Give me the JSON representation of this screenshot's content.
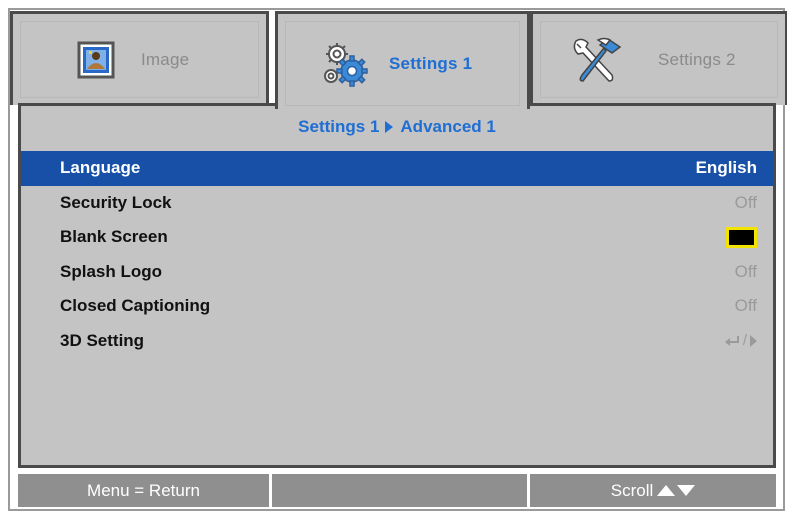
{
  "tabs": [
    {
      "label": "Image",
      "icon": "image-icon",
      "active": false
    },
    {
      "label": "Settings 1",
      "icon": "gears-icon",
      "active": true
    },
    {
      "label": "Settings 2",
      "icon": "tools-icon",
      "active": false
    }
  ],
  "breadcrumb": {
    "parent": "Settings 1",
    "current": "Advanced 1"
  },
  "menu": {
    "items": [
      {
        "name": "Language",
        "value": "English"
      },
      {
        "name": "Security Lock",
        "value": "Off"
      },
      {
        "name": "Blank Screen",
        "value": ""
      },
      {
        "name": "Splash Logo",
        "value": "Off"
      },
      {
        "name": "Closed Captioning",
        "value": "Off"
      },
      {
        "name": "3D Setting",
        "value": ""
      }
    ],
    "selected_index": 0,
    "blank_screen_color": "#000000"
  },
  "footer": {
    "menu_hint": "Menu = Return",
    "scroll_hint": "Scroll"
  },
  "colors": {
    "accent": "#1e6ed4",
    "selection": "#1850a8",
    "panel": "#c4c4c4",
    "border": "#4a4a4a",
    "swatch_border": "#f2e400"
  }
}
